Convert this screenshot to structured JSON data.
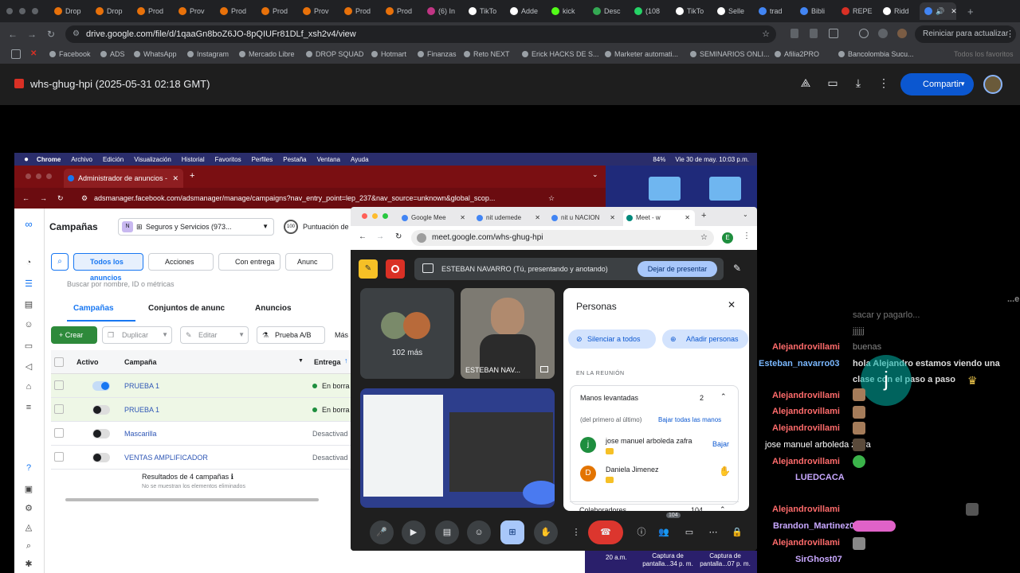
{
  "browser": {
    "tabs": [
      {
        "label": "Drop",
        "color": "#e8710a"
      },
      {
        "label": "Drop",
        "color": "#e8710a"
      },
      {
        "label": "Prod",
        "color": "#e8710a"
      },
      {
        "label": "Prov",
        "color": "#e8710a"
      },
      {
        "label": "Prod",
        "color": "#e8710a"
      },
      {
        "label": "Prod",
        "color": "#e8710a"
      },
      {
        "label": "Prov",
        "color": "#e8710a"
      },
      {
        "label": "Prod",
        "color": "#e8710a"
      },
      {
        "label": "Prod",
        "color": "#e8710a"
      },
      {
        "label": "(6) In",
        "color": "#c13584"
      },
      {
        "label": "TikTo",
        "color": "#ffffff"
      },
      {
        "label": "Adde",
        "color": "#ffffff"
      },
      {
        "label": "kick",
        "color": "#53fc18"
      },
      {
        "label": "Desc",
        "color": "#34a853"
      },
      {
        "label": "(108",
        "color": "#25d366"
      },
      {
        "label": "TikTo",
        "color": "#ffffff"
      },
      {
        "label": "Selle",
        "color": "#ffffff"
      },
      {
        "label": "trad",
        "color": "#4285f4"
      },
      {
        "label": "Bibli",
        "color": "#4285f4"
      },
      {
        "label": "REPE",
        "color": "#d93025"
      },
      {
        "label": "Ridd",
        "color": "#ffffff"
      }
    ],
    "url": "drive.google.com/file/d/1qaaGn8boZ6JO-8pQIUFr81DLf_xsh2v4/view",
    "reload_button": "Reiniciar para actualizar",
    "bookmarks": [
      "Facebook",
      "ADS",
      "WhatsApp",
      "Instagram",
      "Mercado Libre",
      "DROP SQUAD",
      "Hotmart",
      "Finanzas",
      "Reto NEXT",
      "Erick HACKS DE S...",
      "Marketer automati...",
      "SEMINARIOS ONLI...",
      "Afilia2PRO",
      "Bancolombia Sucu...",
      "Todos los favoritos"
    ]
  },
  "drive": {
    "file_title": "whs-ghug-hpi (2025-05-31 02:18 GMT)",
    "share_label": "Compartir"
  },
  "mac_menu": {
    "items": [
      "Chrome",
      "Archivo",
      "Edición",
      "Visualización",
      "Historial",
      "Favoritos",
      "Perfiles",
      "Pestaña",
      "Ventana",
      "Ayuda"
    ],
    "battery": "84%",
    "datetime": "Vie 30 de may.  10:03 p.m."
  },
  "ads": {
    "tab_label": "Administrador de anuncios -",
    "url": "adsmanager.facebook.com/adsmanager/manage/campaigns?nav_entry_point=lep_237&nav_source=unknown&global_scop...",
    "section_title": "Campañas",
    "account": "Seguros y Servicios (973...",
    "score_badge": "100",
    "score_label": "Puntuación de opo",
    "filters": [
      "Todos los anuncios",
      "Acciones",
      "Con entrega",
      "Anunc"
    ],
    "search_placeholder": "Buscar por nombre, ID o métricas",
    "tabs": [
      "Campañas",
      "Conjuntos de anunc",
      "Anuncios"
    ],
    "toolbar": {
      "create": "Crear",
      "duplicate": "Duplicar",
      "edit": "Editar",
      "ab": "Prueba A/B",
      "more": "Más"
    },
    "columns": [
      "Activo",
      "Campaña",
      "Entrega"
    ],
    "rows": [
      {
        "name": "PRUEBA 1",
        "status": "En borra",
        "active": true
      },
      {
        "name": "PRUEBA 1",
        "status": "En borra",
        "active": false
      },
      {
        "name": "Mascarilla",
        "status": "Desactivad",
        "active": false
      },
      {
        "name": "VENTAS AMPLIFICADOR",
        "status": "Desactivad",
        "active": false
      }
    ],
    "results": "Resultados de 4 campañas",
    "results_note": "No se muestran los elementos eliminados"
  },
  "meet": {
    "tabs": [
      "Google Mee",
      "nit udemede",
      "nit u NACION",
      "Meet - w"
    ],
    "url": "meet.google.com/whs-ghug-hpi",
    "presenter": "ESTEBAN NAVARRO (Tú, presentando y anotando)",
    "stop_presenting": "Dejar de presentar",
    "more_count": "102 más",
    "speaker_name": "ESTEBAN NAV...",
    "people": {
      "title": "Personas",
      "mute_all": "Silenciar a todos",
      "add_people": "Añadir personas",
      "section": "EN LA REUNIÓN",
      "raised_hands": "Manos levantadas",
      "raised_count": "2",
      "order_note": "(del primero al último)",
      "lower_all": "Bajar todas las manos",
      "participants": [
        {
          "name": "jose manuel arboleda zafra",
          "initial": "j",
          "color": "#1e8e3e",
          "action": "Bajar"
        },
        {
          "name": "Daniela Jimenez",
          "initial": "D",
          "color": "#e37400",
          "action": ""
        }
      ],
      "collaborators": "Colaboradores",
      "collaborators_count": "104"
    },
    "people_badge": "104"
  },
  "chat": {
    "overlay_lines": [
      "...e",
      "sacar y pagarlo...",
      "jjjjjj",
      "buenas",
      "hola Alejandro estamos viendo una",
      "clase con el paso a paso"
    ],
    "names": [
      {
        "name": "Alejandrovillami",
        "color": "#ff6b6b"
      },
      {
        "name": "Esteban_navarro03",
        "color": "#7ab8ff"
      },
      {
        "name": "Alejandrovillami",
        "color": "#ff6b6b"
      },
      {
        "name": "Alejandrovillami",
        "color": "#ff6b6b"
      },
      {
        "name": "Alejandrovillami",
        "color": "#ff6b6b"
      },
      {
        "name": "jose manuel arboleda zafra",
        "color": "#ffffff"
      },
      {
        "name": "Alejandrovillami",
        "color": "#ff6b6b"
      },
      {
        "name": "LUEDCACA",
        "color": "#c8a8ff"
      },
      {
        "name": "Alejandrovillami",
        "color": "#ff6b6b"
      },
      {
        "name": "Brandon_Martinez02",
        "color": "#c8a8ff"
      },
      {
        "name": "Alejandrovillami",
        "color": "#ff6b6b"
      },
      {
        "name": "SirGhost07",
        "color": "#c8a8ff"
      }
    ],
    "avatar_letter": "j"
  },
  "screenshots": [
    "20 a.m.",
    "Captura de pantalla...34 p. m.",
    "Captura de pantalla...07 p. m."
  ]
}
